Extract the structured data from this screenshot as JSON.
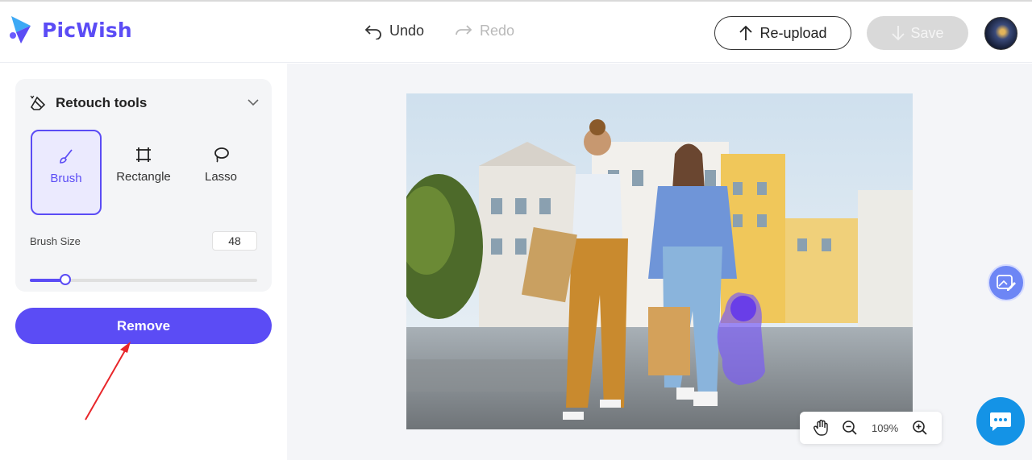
{
  "header": {
    "logo_text": "PicWish",
    "undo_label": "Undo",
    "redo_label": "Redo",
    "reupload_label": "Re-upload",
    "save_label": "Save"
  },
  "sidebar": {
    "panel_title": "Retouch tools",
    "tools": [
      {
        "label": "Brush",
        "active": true
      },
      {
        "label": "Rectangle",
        "active": false
      },
      {
        "label": "Lasso",
        "active": false
      }
    ],
    "brush_size_label": "Brush Size",
    "brush_size_value": "48",
    "brush_size_fraction": 0.155,
    "remove_label": "Remove"
  },
  "canvas": {
    "zoom_label": "109%"
  },
  "colors": {
    "brand": "#5b4cf5",
    "chat": "#1493e6",
    "annotation_arrow": "#e8262a"
  }
}
